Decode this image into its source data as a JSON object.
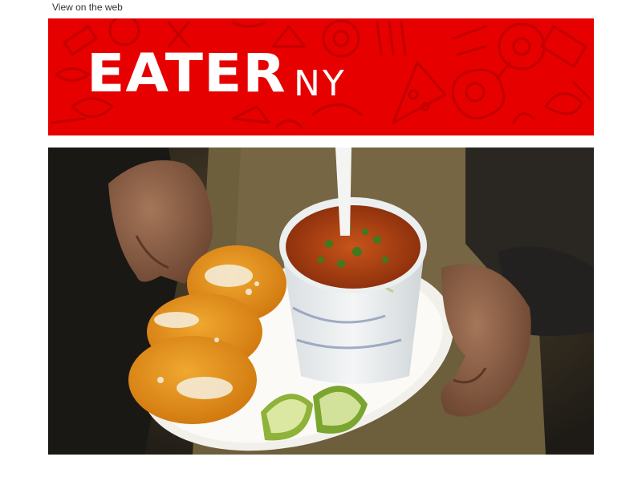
{
  "header": {
    "view_on_web": "View on the web"
  },
  "banner": {
    "logo_text": "EATER",
    "region_text": "NY",
    "background_color": "#e60000",
    "doodle_color": "#c80000"
  },
  "hero": {
    "subject": "hands holding plate of tostadas, cup of soup and lime wedges"
  }
}
